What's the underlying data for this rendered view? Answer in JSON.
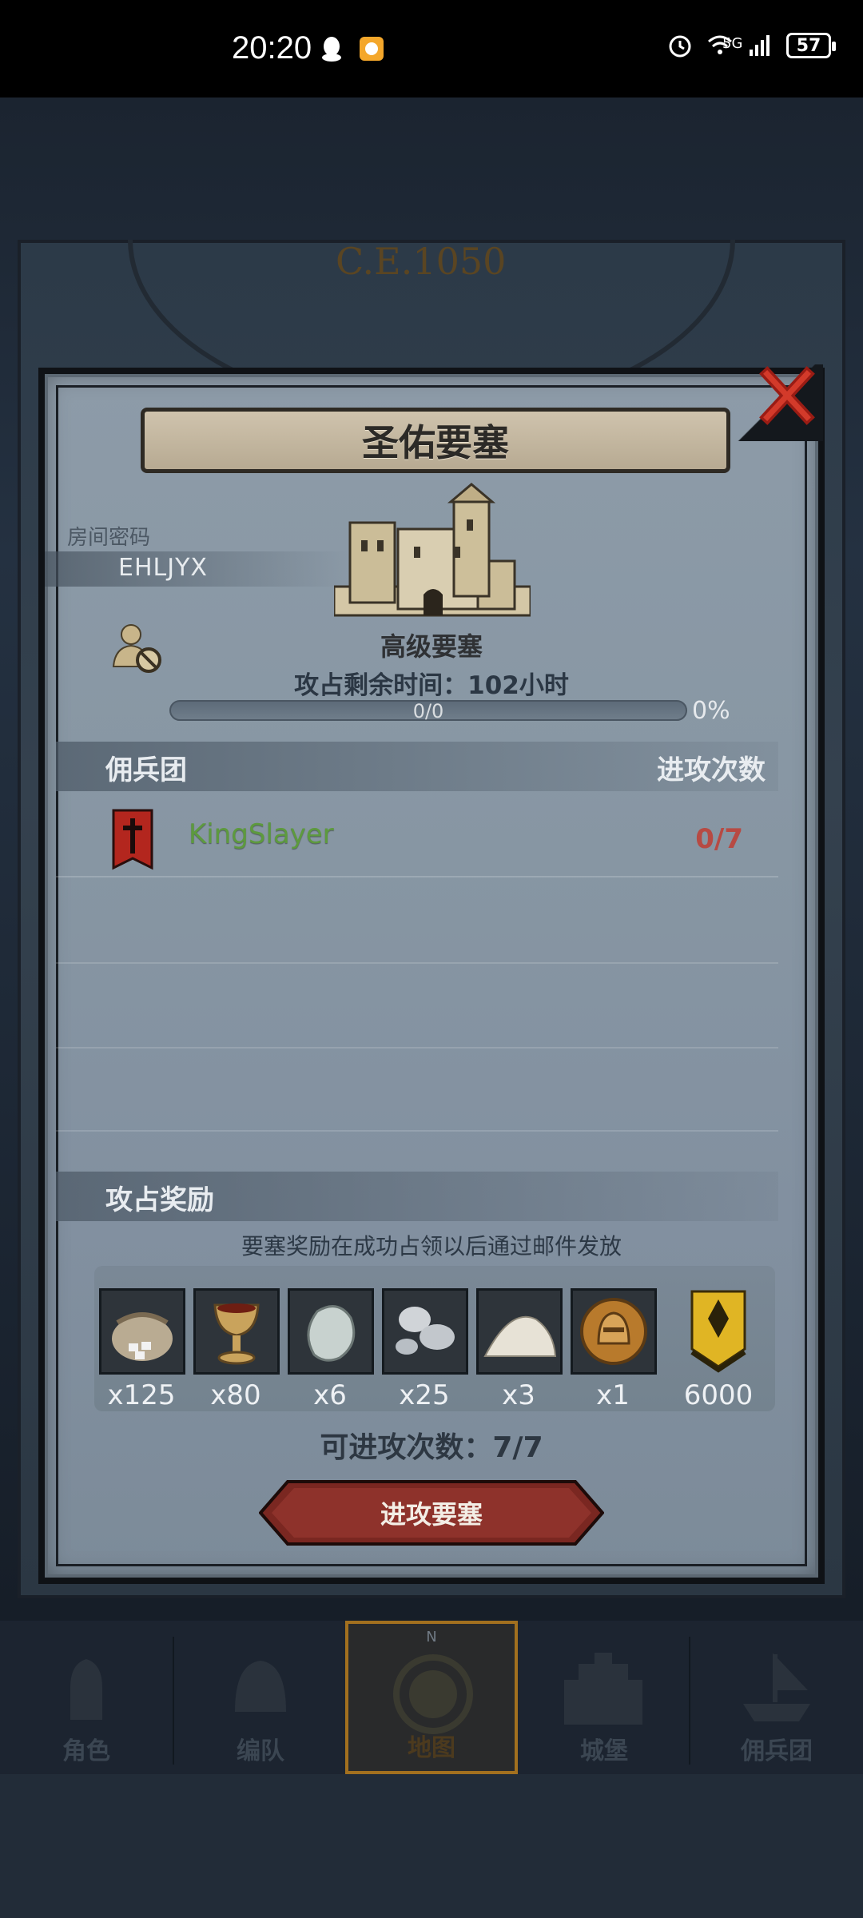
{
  "status_bar": {
    "time": "20:20",
    "network": "5G",
    "battery": "57",
    "icons": [
      "qq-icon",
      "app-notification-icon",
      "alarm-icon",
      "wifi-icon",
      "signal-icon",
      "battery-icon"
    ]
  },
  "background": {
    "year": "C.E.1050"
  },
  "dialog": {
    "title": "圣佑要塞",
    "room_code_label": "房间密码",
    "room_code": "EHLJYX",
    "fort_level": "高级要塞",
    "time_remaining_label": "攻占剩余时间：",
    "time_remaining_value": "102",
    "time_remaining_unit": "小时",
    "progress_text": "0/0",
    "progress_percent": "0%",
    "progress_fraction": 0,
    "mercenary_header": "佣兵团",
    "attack_count_header": "进攻次数",
    "mercenaries": [
      {
        "name": "KingSlayer",
        "attacks": "0/7"
      }
    ],
    "reward_header": "攻占奖励",
    "reward_note": "要塞奖励在成功占领以后通过邮件发放",
    "rewards": [
      {
        "icon": "sack-of-gems-icon",
        "count": "x125"
      },
      {
        "icon": "golden-goblet-icon",
        "count": "x80"
      },
      {
        "icon": "white-stone-icon",
        "count": "x6"
      },
      {
        "icon": "silver-pebbles-icon",
        "count": "x25"
      },
      {
        "icon": "salt-pile-icon",
        "count": "x3"
      },
      {
        "icon": "knight-helmet-coin-icon",
        "count": "x1"
      },
      {
        "icon": "rank-badge-icon",
        "count": "6000"
      }
    ],
    "remaining_attacks": "可进攻次数：7/7",
    "attack_button": "进攻要塞"
  },
  "bottom_nav": {
    "compass_letter": "N",
    "items": [
      {
        "label": "角色",
        "icon": "knight-icon"
      },
      {
        "label": "编队",
        "icon": "helmet-icon"
      },
      {
        "label": "地图",
        "icon": "map-compass-icon",
        "active": true
      },
      {
        "label": "城堡",
        "icon": "castle-icon"
      },
      {
        "label": "佣兵团",
        "icon": "ship-icon"
      }
    ]
  },
  "colors": {
    "accent_gold": "#a2701f",
    "mercenary_green": "#5d9a3e",
    "attack_red": "#b74a43",
    "dialog_bg": "#8796a3"
  }
}
